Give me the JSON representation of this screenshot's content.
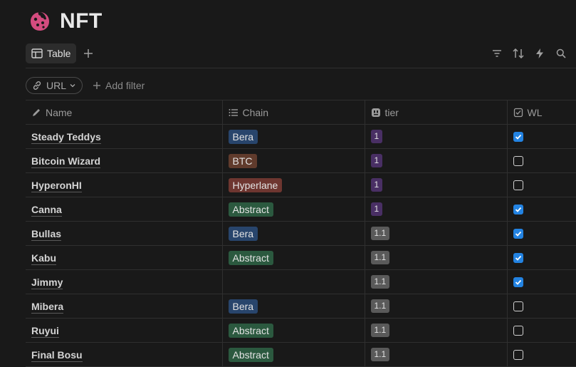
{
  "page": {
    "title": "NFT",
    "icon": "cookie-icon",
    "icon_color": "#d44c7f"
  },
  "views": {
    "active_tab": "Table"
  },
  "toolbar": {
    "icons": [
      "filter-icon",
      "sort-icon",
      "lightning-icon",
      "search-icon"
    ]
  },
  "filters": {
    "url_chip": "URL",
    "add_filter": "Add filter"
  },
  "columns": [
    {
      "label": "Name",
      "icon": "pen-icon"
    },
    {
      "label": "Chain",
      "icon": "list-icon"
    },
    {
      "label": "tier",
      "icon": "tier-icon"
    },
    {
      "label": "WL",
      "icon": "checkbox-icon"
    }
  ],
  "colors": {
    "Bera": "#28456c",
    "BTC": "#603b2c",
    "Hyperlane": "#6e3630",
    "Abstract": "#2b593f",
    "tier_1": "#492f64",
    "tier_1.1": "#5a5a5a",
    "checkbox_on": "#2383e2"
  },
  "rows": [
    {
      "name": "Steady Teddys",
      "chain": "Bera",
      "tier": "1",
      "wl": true
    },
    {
      "name": "Bitcoin Wizard",
      "chain": "BTC",
      "tier": "1",
      "wl": false
    },
    {
      "name": "HyperonHI",
      "chain": "Hyperlane",
      "tier": "1",
      "wl": false
    },
    {
      "name": "Canna",
      "chain": "Abstract",
      "tier": "1",
      "wl": true
    },
    {
      "name": "Bullas",
      "chain": "Bera",
      "tier": "1.1",
      "wl": true
    },
    {
      "name": "Kabu",
      "chain": "Abstract",
      "tier": "1.1",
      "wl": true
    },
    {
      "name": "Jimmy",
      "chain": "",
      "tier": "1.1",
      "wl": true
    },
    {
      "name": "Mibera",
      "chain": "Bera",
      "tier": "1.1",
      "wl": false
    },
    {
      "name": "Ruyui",
      "chain": "Abstract",
      "tier": "1.1",
      "wl": false
    },
    {
      "name": "Final Bosu",
      "chain": "Abstract",
      "tier": "1.1",
      "wl": false
    }
  ]
}
